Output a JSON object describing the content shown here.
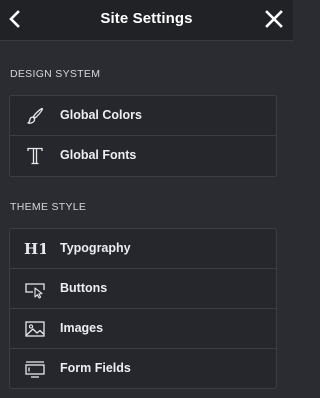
{
  "header": {
    "title": "Site Settings",
    "back_icon": "chevron-left-icon",
    "close_icon": "close-icon"
  },
  "sections": [
    {
      "label": "DESIGN SYSTEM",
      "items": [
        {
          "label": "Global Colors",
          "icon": "brush-icon"
        },
        {
          "label": "Global Fonts",
          "icon": "font-t-icon"
        }
      ]
    },
    {
      "label": "THEME STYLE",
      "items": [
        {
          "label": "Typography",
          "icon": "heading-h1-icon"
        },
        {
          "label": "Buttons",
          "icon": "button-cursor-icon"
        },
        {
          "label": "Images",
          "icon": "image-icon"
        },
        {
          "label": "Form Fields",
          "icon": "form-fields-icon"
        }
      ]
    }
  ],
  "colors": {
    "background": "#2b2c32",
    "header_background": "#212226",
    "border": "#3d3e44",
    "text": "#eceef0"
  }
}
